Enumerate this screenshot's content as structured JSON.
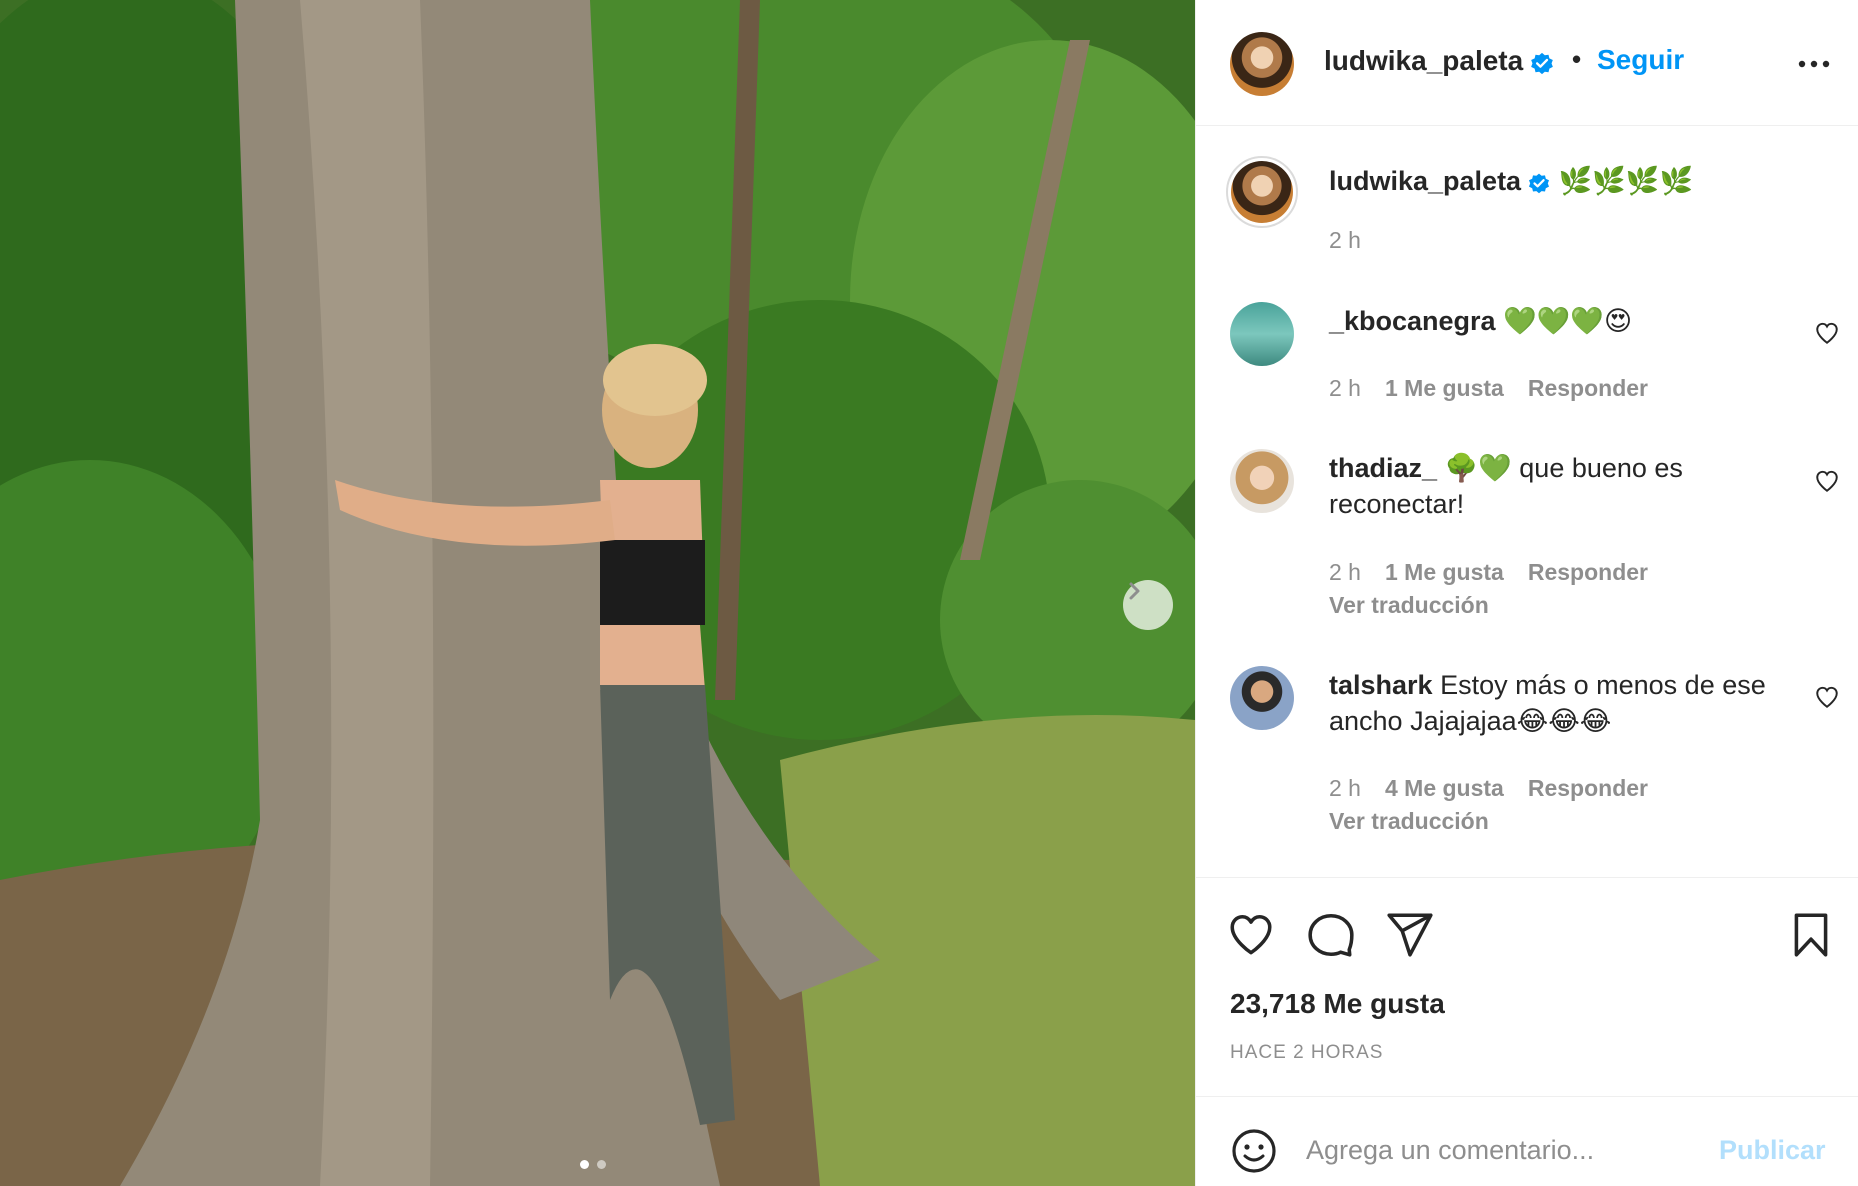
{
  "post_header": {
    "username": "ludwika_paleta",
    "separator": "•",
    "follow_label": "Seguir"
  },
  "caption": {
    "username": "ludwika_paleta",
    "text": "🌿🌿🌿🌿",
    "time": "2 h"
  },
  "comments": [
    {
      "username": "_kbocanegra",
      "text": "💚💚💚😍",
      "time": "2 h",
      "likes": "1 Me gusta",
      "reply": "Responder",
      "translate": ""
    },
    {
      "username": "thadiaz_",
      "text": "🌳💚 que bueno es reconectar!",
      "time": "2 h",
      "likes": "1 Me gusta",
      "reply": "Responder",
      "translate": "Ver traducción"
    },
    {
      "username": "talshark",
      "text": "Estoy más o menos de ese ancho Jajajajaa😂😂😂",
      "time": "2 h",
      "likes": "4 Me gusta",
      "reply": "Responder",
      "translate": "Ver traducción"
    }
  ],
  "actions": {
    "like_count": "23,718 Me gusta",
    "posted_time": "HACE 2 HORAS"
  },
  "add_comment": {
    "placeholder": "Agrega un comentario...",
    "publish_label": "Publicar"
  },
  "carousel": {
    "current_slide": 1,
    "total_slides": 2
  },
  "colors": {
    "accent": "#0095f6",
    "publish_disabled": "#b2dffc",
    "muted": "#8e8e8e",
    "text": "#262626"
  },
  "icons": [
    "verified-badge-icon",
    "more-options-icon",
    "heart-icon",
    "comment-icon",
    "share-icon",
    "bookmark-icon",
    "emoji-icon",
    "chevron-right-icon"
  ]
}
